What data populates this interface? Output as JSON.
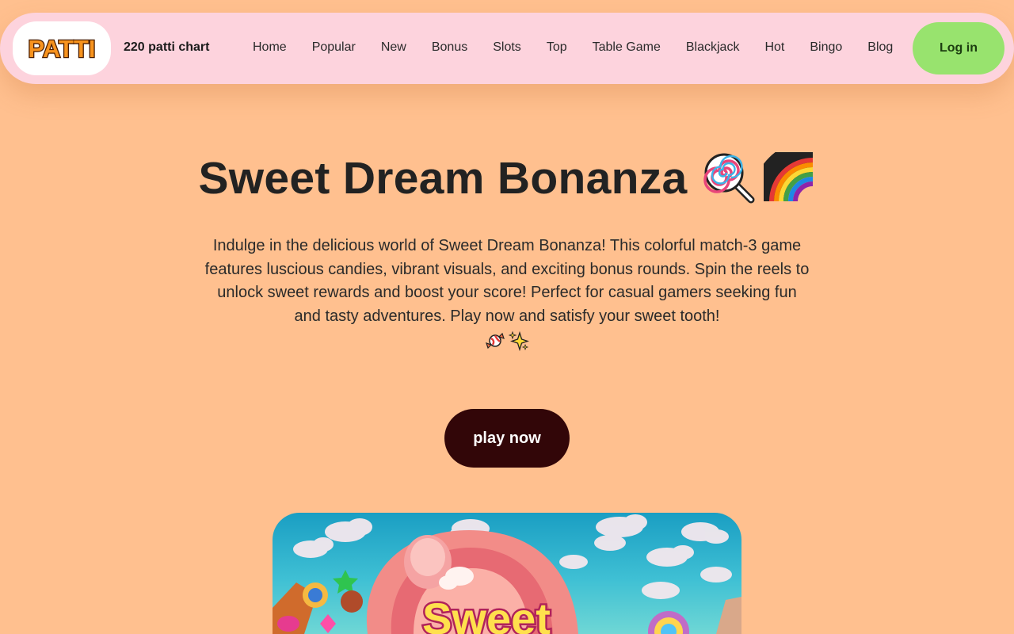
{
  "header": {
    "logo_text": "PATTI",
    "site_title": "220 patti chart",
    "nav": [
      "Home",
      "Popular",
      "New",
      "Bonus",
      "Slots",
      "Top",
      "Table Game",
      "Blackjack",
      "Hot",
      "Bingo",
      "Blog"
    ],
    "login_label": "Log in"
  },
  "hero": {
    "title": "Sweet Dream Bonanza",
    "title_icons": [
      "lollipop-icon",
      "rainbow-icon"
    ],
    "description": "Indulge in the delicious world of Sweet Dream Bonanza! This colorful match-3 game features luscious candies, vibrant visuals, and exciting bonus rounds. Spin the reels to unlock sweet rewards and boost your score! Perfect for casual gamers seeking fun and tasty adventures. Play now and satisfy your sweet tooth!",
    "description_icons": [
      "candy-icon",
      "sparkles-icon"
    ],
    "play_label": "play now"
  },
  "banner": {
    "text": "Sweet"
  },
  "colors": {
    "background": "#ffc08f",
    "header_bg": "#fdd3dd",
    "login_bg": "#98e36e",
    "play_bg": "#320608"
  }
}
